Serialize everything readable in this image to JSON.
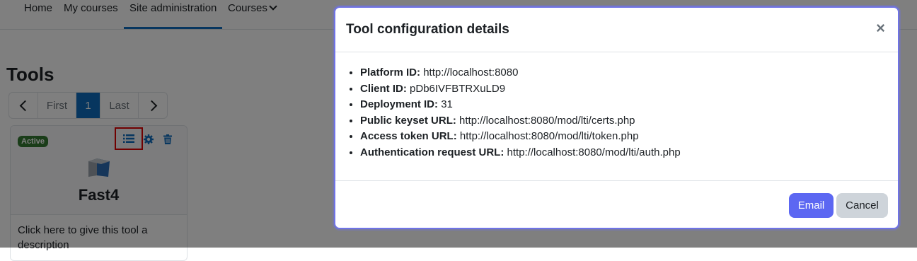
{
  "nav": {
    "items": [
      {
        "label": "Home"
      },
      {
        "label": "My courses"
      },
      {
        "label": "Site administration"
      },
      {
        "label": "Courses"
      }
    ]
  },
  "page": {
    "title": "Tools"
  },
  "pagination": {
    "first": "First",
    "current": "1",
    "last": "Last"
  },
  "tool_card": {
    "status": "Active",
    "name": "Fast4",
    "description": "Click here to give this tool a description"
  },
  "modal": {
    "title": "Tool configuration details",
    "close_glyph": "×",
    "details": [
      {
        "label": "Platform ID:",
        "value": "http://localhost:8080"
      },
      {
        "label": "Client ID:",
        "value": "pDb6IVFBTRXuLD9"
      },
      {
        "label": "Deployment ID:",
        "value": "31"
      },
      {
        "label": "Public keyset URL:",
        "value": "http://localhost:8080/mod/lti/certs.php"
      },
      {
        "label": "Access token URL:",
        "value": "http://localhost:8080/mod/lti/token.php"
      },
      {
        "label": "Authentication request URL:",
        "value": "http://localhost:8080/mod/lti/auth.php"
      }
    ],
    "email_label": "Email",
    "cancel_label": "Cancel"
  },
  "colors": {
    "primary": "#5c67f2",
    "active_badge": "#357a32",
    "highlight_box": "#e00000"
  }
}
